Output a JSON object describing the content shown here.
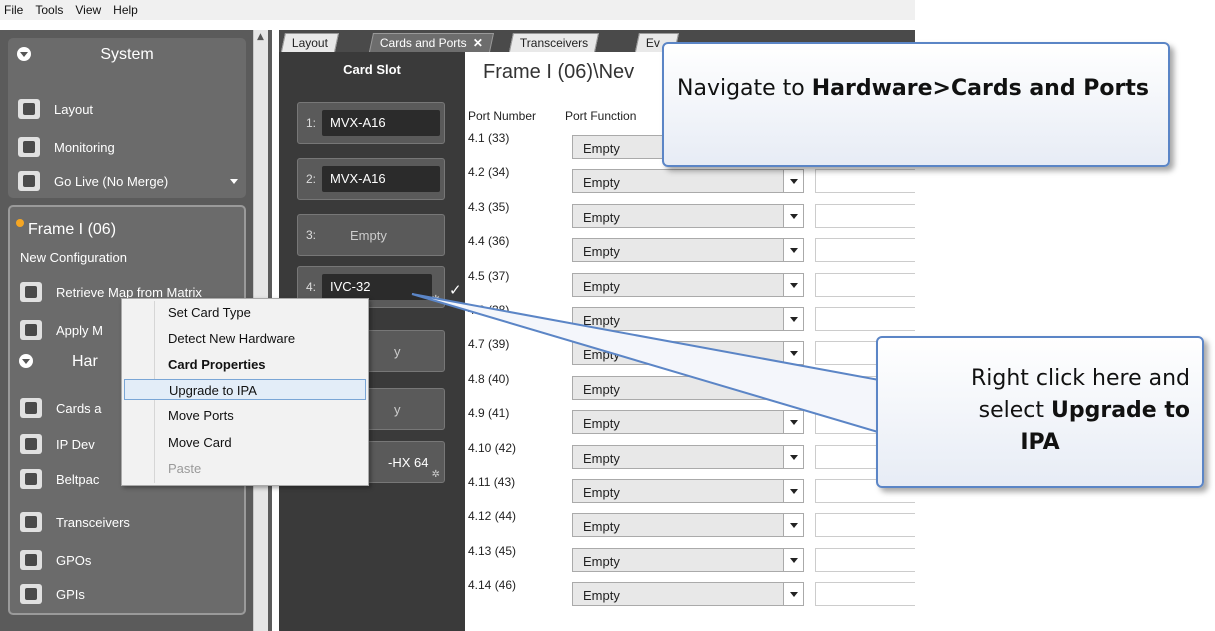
{
  "menubar": {
    "items": [
      "File",
      "Tools",
      "View",
      "Help"
    ]
  },
  "sidebar": {
    "system": {
      "title": "System",
      "items": [
        {
          "label": "Layout",
          "icon": "layout-icon"
        },
        {
          "label": "Monitoring",
          "icon": "monitoring-icon"
        },
        {
          "label": "Go Live (No Merge)",
          "icon": "go-live-icon"
        }
      ]
    },
    "frame": {
      "title": "Frame I (06)",
      "subtitle": "New Configuration",
      "status_color": "#f5a623",
      "items": [
        {
          "label": "Retrieve Map from Matrix",
          "icon": "retrieve-map-icon"
        },
        {
          "label": "Apply M",
          "icon": "apply-map-icon"
        }
      ]
    },
    "hardware": {
      "title": "Har",
      "items": [
        {
          "label": "Cards a",
          "icon": "cards-icon"
        },
        {
          "label": "IP Dev",
          "icon": "ip-devices-icon"
        },
        {
          "label": "Beltpac",
          "icon": "beltpack-icon"
        },
        {
          "label": "Transceivers",
          "icon": "transceiver-icon"
        },
        {
          "label": "GPOs",
          "icon": "gpo-icon"
        },
        {
          "label": "GPIs",
          "icon": "gpi-icon"
        }
      ]
    }
  },
  "tabs": [
    {
      "label": "Layout",
      "active": false
    },
    {
      "label": "Cards and Ports",
      "active": true,
      "close": "✕"
    },
    {
      "label": "Transceivers",
      "active": false
    },
    {
      "label": "Ev",
      "active": false
    }
  ],
  "cardslot": {
    "header": "Card Slot",
    "slots": [
      {
        "num": "1:",
        "card": "MVX-A16"
      },
      {
        "num": "2:",
        "card": "MVX-A16"
      },
      {
        "num": "3:",
        "empty": "Empty"
      },
      {
        "num": "4:",
        "card": "IVC-32"
      },
      {
        "empty": "y"
      },
      {
        "empty": "y"
      },
      {
        "card": "-HX 64"
      }
    ]
  },
  "porttable": {
    "heading": "Frame I (06)\\Nev",
    "columns": [
      "Port Number",
      "Port Function"
    ],
    "rows": [
      {
        "port": "4.1 (33)",
        "func": "Empty"
      },
      {
        "port": "4.2 (34)",
        "func": "Empty"
      },
      {
        "port": "4.3 (35)",
        "func": "Empty"
      },
      {
        "port": "4.4 (36)",
        "func": "Empty"
      },
      {
        "port": "4.5 (37)",
        "func": "Empty"
      },
      {
        "port": "4.6 (38)",
        "func": "Empty"
      },
      {
        "port": "4.7 (39)",
        "func": "Empty"
      },
      {
        "port": "4.8 (40)",
        "func": "Empty"
      },
      {
        "port": "4.9 (41)",
        "func": "Empty"
      },
      {
        "port": "4.10 (42)",
        "func": "Empty"
      },
      {
        "port": "4.11 (43)",
        "func": "Empty"
      },
      {
        "port": "4.12 (44)",
        "func": "Empty"
      },
      {
        "port": "4.13 (45)",
        "func": "Empty"
      },
      {
        "port": "4.14 (46)",
        "func": "Empty"
      }
    ]
  },
  "context_menu": {
    "items": [
      {
        "label": "Set Card Type"
      },
      {
        "label": "Detect New Hardware"
      },
      {
        "label": "Card Properties",
        "bold": true
      },
      {
        "label": "Upgrade to IPA",
        "highlighted": true
      },
      {
        "label": "Move Ports"
      },
      {
        "label": "Move Card"
      },
      {
        "label": "Paste",
        "disabled": true
      }
    ]
  },
  "callouts": {
    "top": {
      "text_pre": "Navigate to ",
      "text_bold": "Hardware>Cards and Ports"
    },
    "bottom": {
      "line1": "Right click here and",
      "line2_pre": "select ",
      "line2_bold": "Upgrade to",
      "line3_bold": "IPA"
    }
  },
  "colors": {
    "accent_border": "#5b85c6",
    "panel_dark": "#5b5b5b"
  }
}
